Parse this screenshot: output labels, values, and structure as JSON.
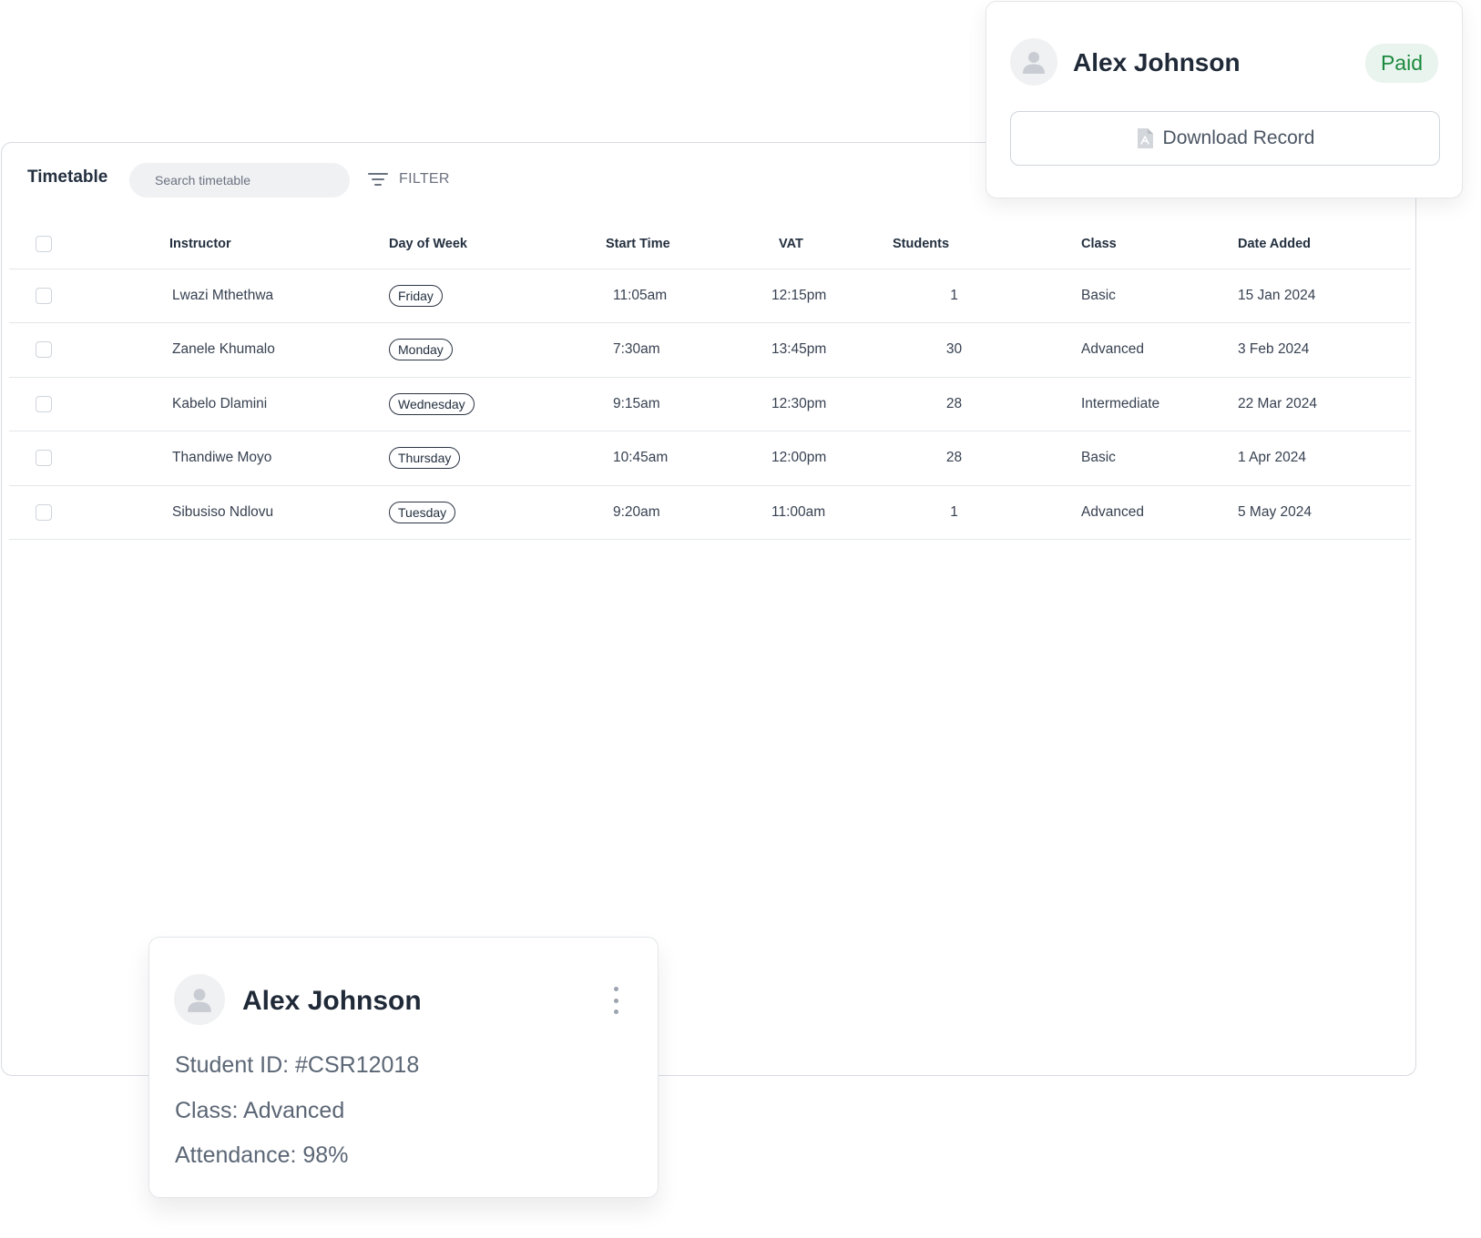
{
  "toolbar": {
    "title": "Timetable",
    "search_placeholder": "Search timetable",
    "filter_label": "FILTER"
  },
  "table": {
    "columns": [
      "Instructor",
      "Day of Week",
      "Start Time",
      "VAT",
      "Students",
      "Class",
      "Date Added"
    ],
    "rows": [
      {
        "instructor": "Lwazi Mthethwa",
        "day": "Friday",
        "start": "11:05am",
        "vat": "12:15pm",
        "students": "1",
        "class": "Basic",
        "date": "15 Jan 2024"
      },
      {
        "instructor": "Zanele Khumalo",
        "day": "Monday",
        "start": "7:30am",
        "vat": "13:45pm",
        "students": "30",
        "class": "Advanced",
        "date": "3 Feb 2024"
      },
      {
        "instructor": "Kabelo Dlamini",
        "day": "Wednesday",
        "start": "9:15am",
        "vat": "12:30pm",
        "students": "28",
        "class": "Intermediate",
        "date": "22 Mar 2024"
      },
      {
        "instructor": "Thandiwe Moyo",
        "day": "Thursday",
        "start": "10:45am",
        "vat": "12:00pm",
        "students": "28",
        "class": "Basic",
        "date": "1 Apr 2024"
      },
      {
        "instructor": "Sibusiso Ndlovu",
        "day": "Tuesday",
        "start": "9:20am",
        "vat": "11:00am",
        "students": "1",
        "class": "Advanced",
        "date": "5 May 2024"
      }
    ]
  },
  "record_card": {
    "name": "Alex Johnson",
    "status": "Paid",
    "download_label": "Download Record"
  },
  "student_card": {
    "name": "Alex Johnson",
    "student_id": "Student ID: #CSR12018",
    "class": "Class: Advanced",
    "attendance": "Attendance: 98%"
  },
  "colors": {
    "accent_green": "#1b8a3e",
    "paid_bg": "#eaf4ee",
    "border": "#d7dbe0"
  },
  "icons": {
    "filter": "filter-lines-icon",
    "avatar": "user-icon",
    "download": "pdf-file-icon",
    "menu": "kebab-menu-icon"
  }
}
